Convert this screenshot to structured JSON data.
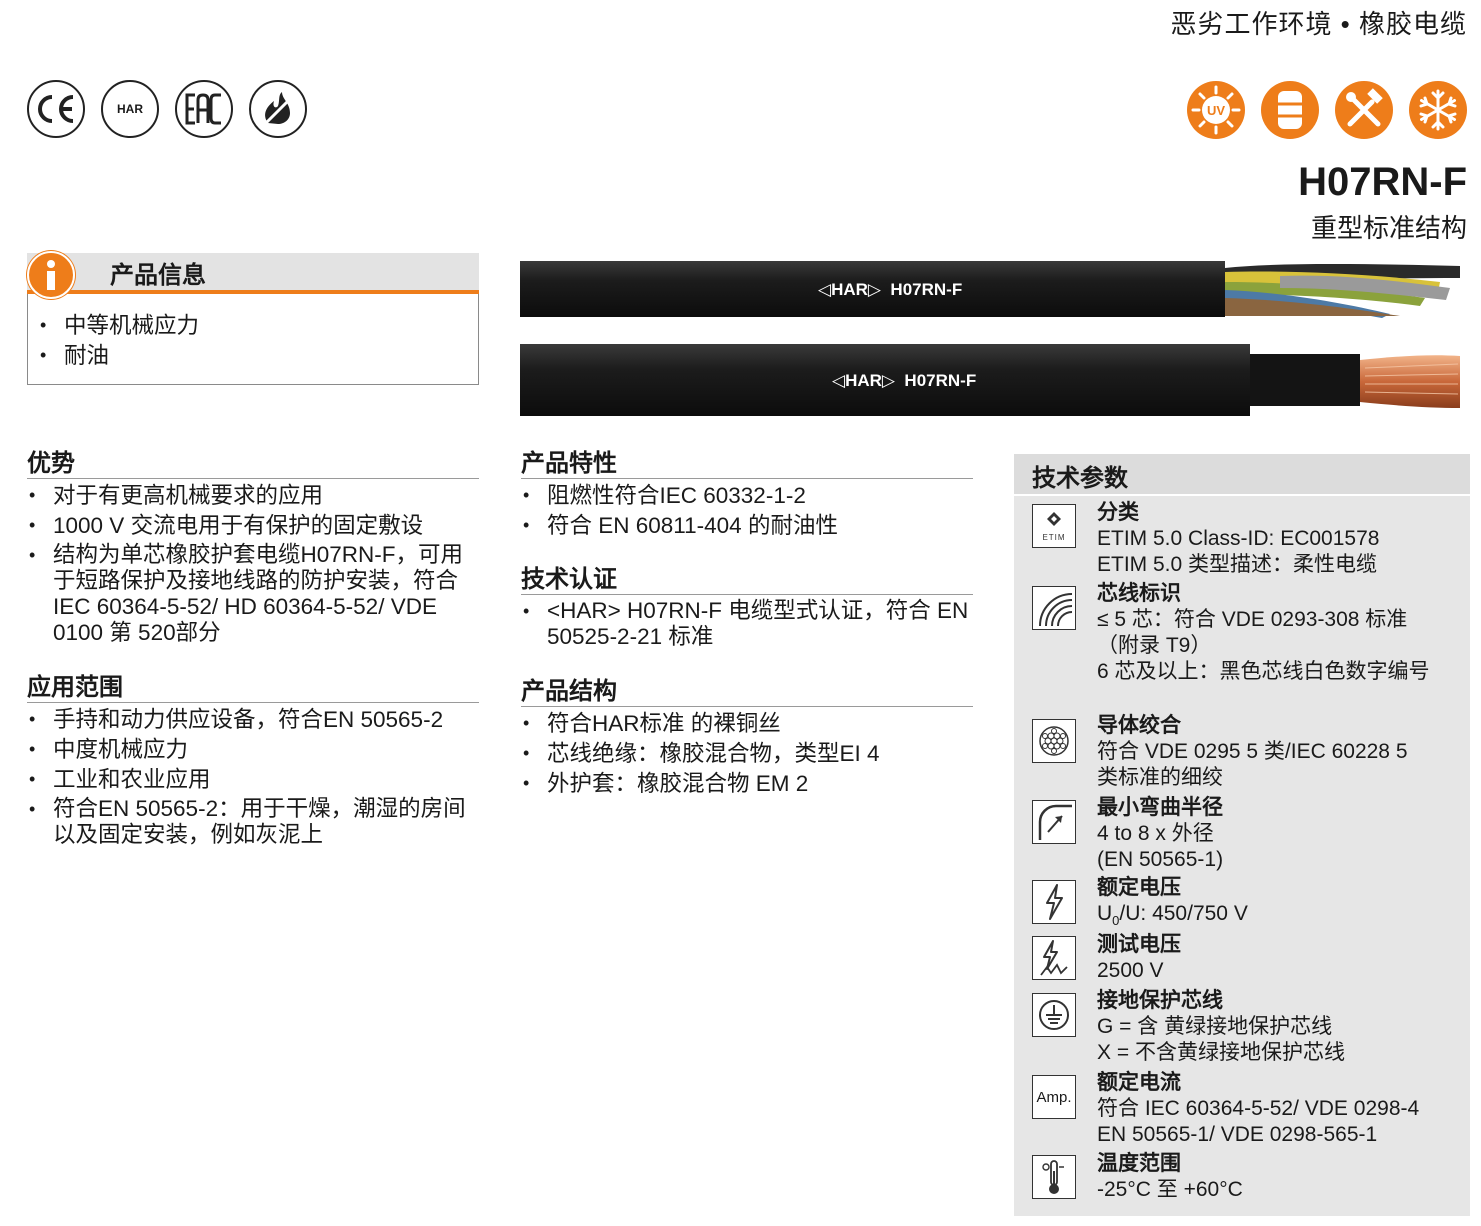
{
  "header": {
    "category": "恶劣工作环境 • 橡胶电缆",
    "model": "H07RN-F",
    "model_subtitle": "重型标准结构"
  },
  "cert_icons": [
    "ce-mark-icon",
    "har-mark-icon",
    "eac-mark-icon",
    "flame-retardant-icon"
  ],
  "cert_labels": {
    "ce": "CE",
    "har": "HAR",
    "eac": "EAC"
  },
  "property_icons": [
    "uv-resistant-icon",
    "oil-resistant-icon",
    "mechanical-stress-icon",
    "cold-resistant-icon"
  ],
  "uv_label": "UV",
  "product_info": {
    "title": "产品信息",
    "items": [
      "中等机械应力",
      "耐油"
    ]
  },
  "cable_print": {
    "top": "◁HAR▷  H07RN-F",
    "bottom": "◁HAR▷  H07RN-F"
  },
  "advantages": {
    "title": "优势",
    "items": [
      "对于有更高机械要求的应用",
      "1000 V 交流电用于有保护的固定敷设",
      "结构为单芯橡胶护套电缆H07RN-F，可用于短路保护及接地线路的防护安装，符合IEC 60364-5-52/ HD 60364-5-52/ VDE 0100 第 520部分"
    ]
  },
  "applications": {
    "title": "应用范围",
    "items": [
      "手持和动力供应设备，符合EN 50565-2",
      "中度机械应力",
      "工业和农业应用",
      "符合EN 50565-2：用于干燥，潮湿的房间以及固定安装，例如灰泥上"
    ]
  },
  "features": {
    "title": "产品特性",
    "items": [
      "阻燃性符合IEC 60332-1-2",
      "符合 EN 60811-404 的耐油性"
    ]
  },
  "certification": {
    "title": "技术认证",
    "items": [
      "<HAR> H07RN-F 电缆型式认证，符合 EN 50525-2-21 标准"
    ]
  },
  "structure": {
    "title": "产品结构",
    "items": [
      "符合HAR标准 的裸铜丝",
      "芯线绝缘：橡胶混合物，类型EI 4",
      "外护套：橡胶混合物 EM 2"
    ]
  },
  "tech": {
    "title": "技术参数",
    "etim_label": "ETIM",
    "amp_label": "Amp.",
    "classification": {
      "title": "分类",
      "l1": "ETIM 5.0 Class-ID: EC001578",
      "l2": "ETIM 5.0 类型描述：柔性电缆"
    },
    "core_id": {
      "title": "芯线标识",
      "l1": "≤ 5 芯：符合 VDE 0293-308 标准",
      "l2": "（附录 T9）",
      "l3": "6 芯及以上：黑色芯线白色数字编号"
    },
    "conductor": {
      "title": "导体绞合",
      "l1": "符合 VDE 0295 5 类/IEC 60228 5",
      "l2": "类标准的细绞"
    },
    "bending": {
      "title": "最小弯曲半径",
      "l1": "4 to 8 x 外径",
      "l2": "(EN 50565-1)"
    },
    "rated_voltage": {
      "title": "额定电压",
      "u": "U",
      "sub": "0",
      "rest": "/U: 450/750 V"
    },
    "test_voltage": {
      "title": "测试电压",
      "l1": "2500 V"
    },
    "earth": {
      "title": "接地保护芯线",
      "l1": "G = 含 黄绿接地保护芯线",
      "l2": "X = 不含黄绿接地保护芯线"
    },
    "current": {
      "title": "额定电流",
      "l1": "符合 IEC 60364-5-52/ VDE 0298-4",
      "l2": "EN 50565-1/ VDE 0298-565-1"
    },
    "temperature": {
      "title": "温度范围",
      "l1": "-25°C 至 +60°C"
    }
  }
}
